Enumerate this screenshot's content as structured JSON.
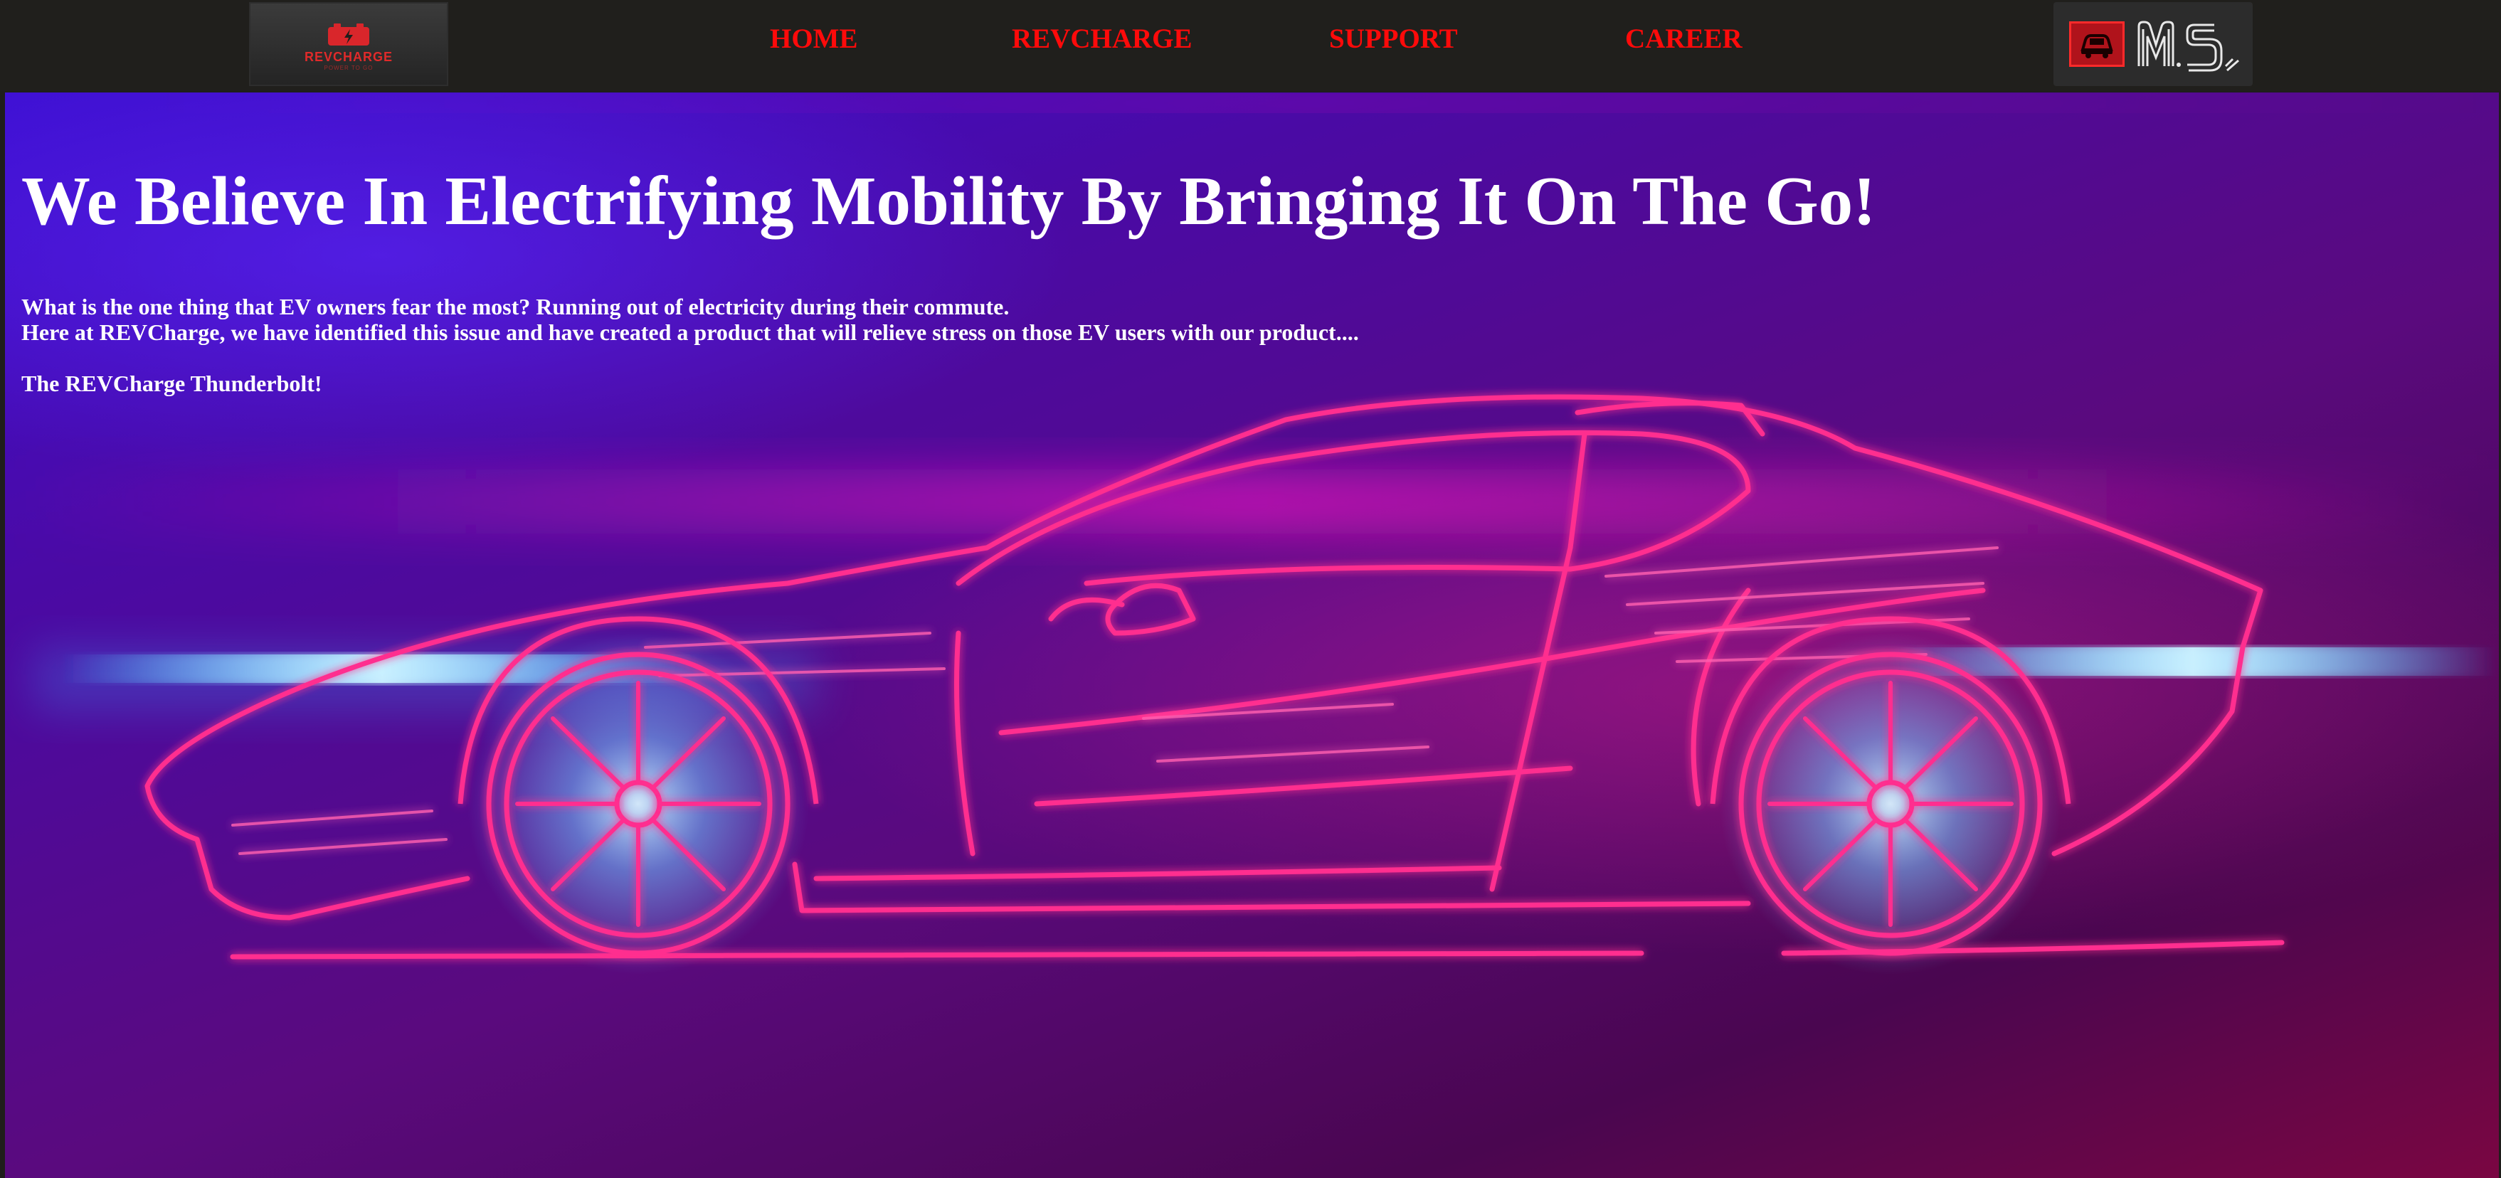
{
  "brand": {
    "logo_text": "REVCHARGE",
    "logo_subtext": "POWER TO GO",
    "logo_icon": "battery-bolt-icon"
  },
  "nav": {
    "items": [
      {
        "label": "HOME"
      },
      {
        "label": "REVCHARGE"
      },
      {
        "label": "SUPPORT"
      },
      {
        "label": "CAREER"
      }
    ]
  },
  "partner_logos": {
    "car_badge_icon": "car-badge-icon",
    "monogram_icon": "ms-monogram-icon"
  },
  "hero": {
    "headline": "We Believe In Electrifying Mobility By Bringing It On The Go!",
    "paragraph_line_1": "What is the one thing that EV owners fear the most? Running out of electricity during their commute.",
    "paragraph_line_2": "Here at REVCharge, we have identified this issue and have created a product that will relieve stress on those EV users with our product....",
    "product_line": "The REVCharge Thunderbolt!",
    "background_image": "neon-sports-car-illustration"
  },
  "colors": {
    "nav_bg": "#201f1c",
    "nav_link": "#ff0a0a",
    "hero_text": "#ffffff",
    "neon_pink": "#ff2f8f",
    "neon_blue": "#5fd0ff"
  }
}
